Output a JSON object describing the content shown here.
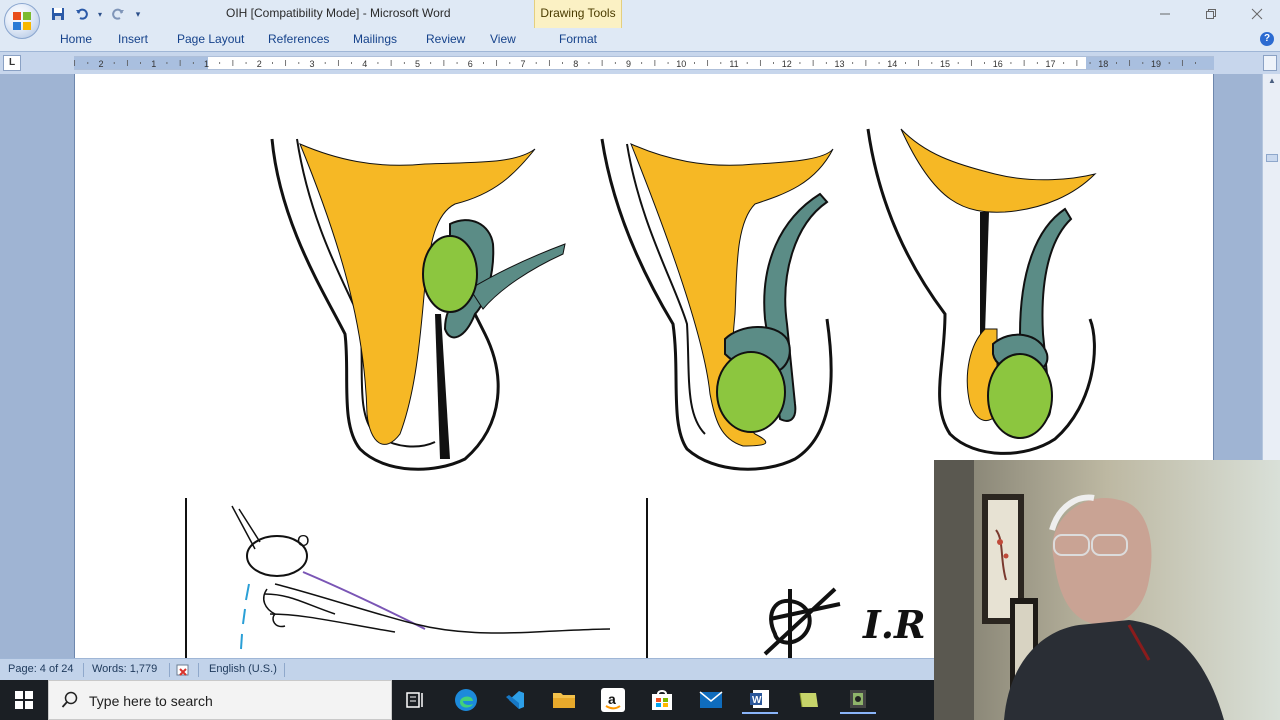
{
  "window": {
    "title": "OIH [Compatibility Mode] - Microsoft Word",
    "context_tab": "Drawing Tools"
  },
  "ribbon": {
    "tabs": [
      "Home",
      "Insert",
      "Page Layout",
      "References",
      "Mailings",
      "Review",
      "View",
      "Format"
    ]
  },
  "ruler": {
    "numbers": [
      "2",
      "1",
      "1",
      "2",
      "3",
      "4",
      "5",
      "6",
      "7",
      "8",
      "9",
      "10",
      "11",
      "12",
      "13",
      "14",
      "15",
      "16",
      "17",
      "18",
      "19"
    ]
  },
  "document": {
    "figure_label_o": "O",
    "signature_text": "I.R"
  },
  "status": {
    "page": "Page: 4 of 24",
    "words": "Words: 1,779",
    "language": "English (U.S.)"
  },
  "taskbar": {
    "search_placeholder": "Type here to search",
    "icons": [
      "task-view-icon",
      "edge-icon",
      "visual-studio-icon",
      "file-explorer-icon",
      "amazon-icon",
      "store-icon",
      "mail-icon",
      "word-icon",
      "notes-icon",
      "media-icon"
    ]
  },
  "colors": {
    "ribbon_bg": "#dfe9f5",
    "ribbon_text": "#15428b",
    "yellow": "#f6b825",
    "green": "#8cc63f",
    "teal": "#5b8c86",
    "taskbar_bg": "#1b1f24"
  }
}
